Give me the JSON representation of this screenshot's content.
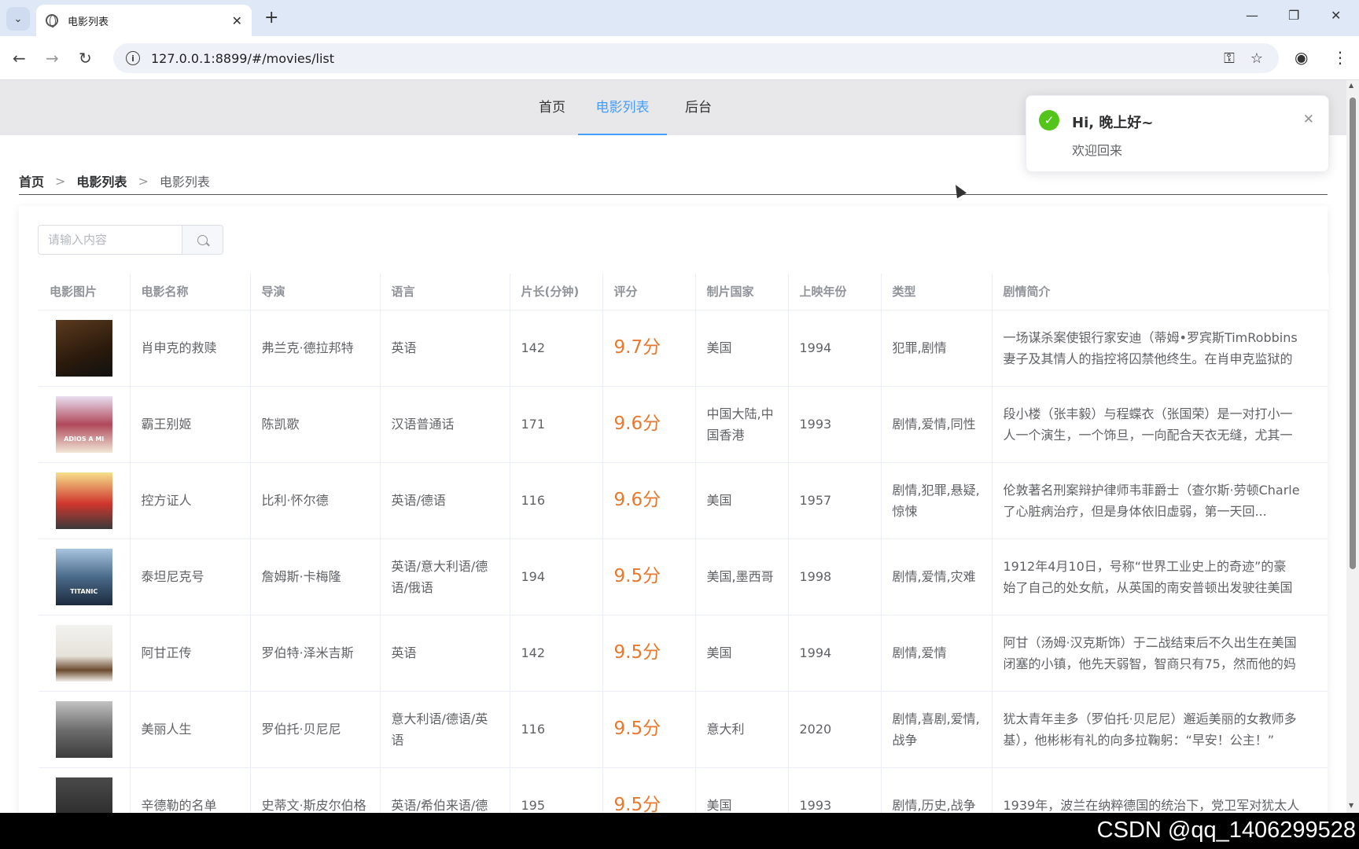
{
  "browser": {
    "tab_title": "电影列表",
    "url": "127.0.0.1:8899/#/movies/list"
  },
  "nav": {
    "items": [
      {
        "label": "首页",
        "active": false
      },
      {
        "label": "电影列表",
        "active": true
      },
      {
        "label": "后台",
        "active": false
      }
    ]
  },
  "breadcrumb": {
    "home": "首页",
    "section": "电影列表",
    "current": "电影列表",
    "separator": ">"
  },
  "search": {
    "placeholder": "请输入内容"
  },
  "table": {
    "columns": [
      "电影图片",
      "电影名称",
      "导演",
      "语言",
      "片长(分钟)",
      "评分",
      "制片国家",
      "上映年份",
      "类型",
      "剧情简介"
    ],
    "rows": [
      {
        "name": "肖申克的救赎",
        "director": "弗兰克·德拉邦特",
        "language": "英语",
        "length": "142",
        "score": "9.7分",
        "country": "美国",
        "year": "1994",
        "genre": "犯罪,剧情",
        "desc_line1": "一场谋杀案使银行家安迪（蒂姆•罗宾斯TimRobbins",
        "desc_line2": "妻子及其情人的指控将囚禁他终生。在肖申克监狱的"
      },
      {
        "name": "霸王别姬",
        "director": "陈凯歌",
        "language": "汉语普通话",
        "length": "171",
        "score": "9.6分",
        "country": "中国大陆,中国香港",
        "year": "1993",
        "genre": "剧情,爱情,同性",
        "desc_line1": "段小楼（张丰毅）与程蝶衣（张国荣）是一对打小一",
        "desc_line2": "人一个演生，一个饰旦，一向配合天衣无缝，尤其一"
      },
      {
        "name": "控方证人",
        "director": "比利·怀尔德",
        "language": "英语/德语",
        "length": "116",
        "score": "9.6分",
        "country": "美国",
        "year": "1957",
        "genre": "剧情,犯罪,悬疑,惊悚",
        "desc_line1": "伦敦著名刑案辩护律师韦菲爵士（查尔斯·劳顿Charle",
        "desc_line2": "了心脏病治疗，但是身体依旧虚弱，第一天回..."
      },
      {
        "name": "泰坦尼克号",
        "director": "詹姆斯·卡梅隆",
        "language": "英语/意大利语/德语/俄语",
        "length": "194",
        "score": "9.5分",
        "country": "美国,墨西哥",
        "year": "1998",
        "genre": "剧情,爱情,灾难",
        "desc_line1": "1912年4月10日，号称“世界工业史上的奇迹”的豪",
        "desc_line2": "始了自己的处女航，从英国的南安普顿出发驶往美国"
      },
      {
        "name": "阿甘正传",
        "director": "罗伯特·泽米吉斯",
        "language": "英语",
        "length": "142",
        "score": "9.5分",
        "country": "美国",
        "year": "1994",
        "genre": "剧情,爱情",
        "desc_line1": "阿甘（汤姆·汉克斯饰）于二战结束后不久出生在美国",
        "desc_line2": "闭塞的小镇，他先天弱智，智商只有75，然而他的妈"
      },
      {
        "name": "美丽人生",
        "director": "罗伯托·贝尼尼",
        "language": "意大利语/德语/英语",
        "length": "116",
        "score": "9.5分",
        "country": "意大利",
        "year": "2020",
        "genre": "剧情,喜剧,爱情,战争",
        "desc_line1": "犹太青年圭多（罗伯托·贝尼尼）邂逅美丽的女教师多",
        "desc_line2": "基），他彬彬有礼的向多拉鞠躬：“早安！公主！”"
      },
      {
        "name": "辛德勒的名单",
        "director": "史蒂文·斯皮尔伯格",
        "language": "英语/希伯来语/德",
        "length": "195",
        "score": "9.5分",
        "country": "美国",
        "year": "1993",
        "genre": "剧情,历史,战争",
        "desc_line1": "1939年，波兰在纳粹德国的统治下，党卫军对犹太人",
        "desc_line2": ""
      }
    ]
  },
  "posters": [
    {
      "label": ""
    },
    {
      "label": "ADIOS A MI"
    },
    {
      "label": ""
    },
    {
      "label": "TITANIC"
    },
    {
      "label": ""
    },
    {
      "label": ""
    },
    {
      "label": ""
    }
  ],
  "notification": {
    "title": "Hi, 晚上好~",
    "message": "欢迎回来"
  },
  "watermark": "CSDN @qq_1406299528",
  "colors": {
    "accent": "#409eff",
    "score": "#e6792e",
    "success": "#52c41a"
  }
}
